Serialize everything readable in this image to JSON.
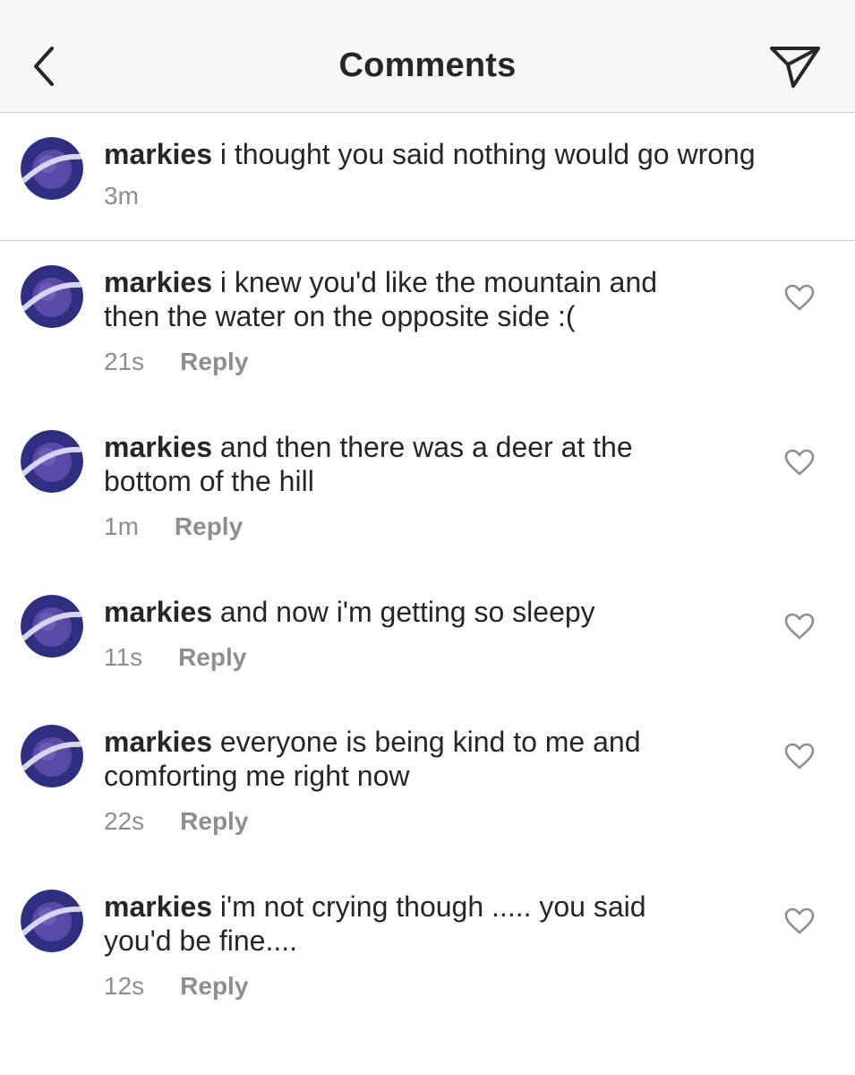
{
  "header": {
    "title": "Comments",
    "back_icon": "chevron-left-icon",
    "share_icon": "paper-plane-icon"
  },
  "caption": {
    "username": "markies",
    "text": "i thought you said nothing would go wrong",
    "time": "3m"
  },
  "comments": [
    {
      "username": "markies",
      "text": "i knew you'd like the mountain and then the water on the opposite side :(",
      "time": "21s",
      "reply_label": "Reply"
    },
    {
      "username": "markies",
      "text": "and then there was a deer at the bottom of the hill",
      "time": "1m",
      "reply_label": "Reply"
    },
    {
      "username": "markies",
      "text": "and now i'm getting so sleepy",
      "time": "11s",
      "reply_label": "Reply"
    },
    {
      "username": "markies",
      "text": "everyone is being kind to me and comforting me right now",
      "time": "22s",
      "reply_label": "Reply"
    },
    {
      "username": "markies",
      "text": "i'm not crying though ..... you said you'd be fine....",
      "time": "12s",
      "reply_label": "Reply"
    }
  ],
  "colors": {
    "text": "#262626",
    "secondary": "#8e8e8e",
    "header_bg": "#f7f7f7",
    "avatar_bg": "#2e2f80"
  }
}
